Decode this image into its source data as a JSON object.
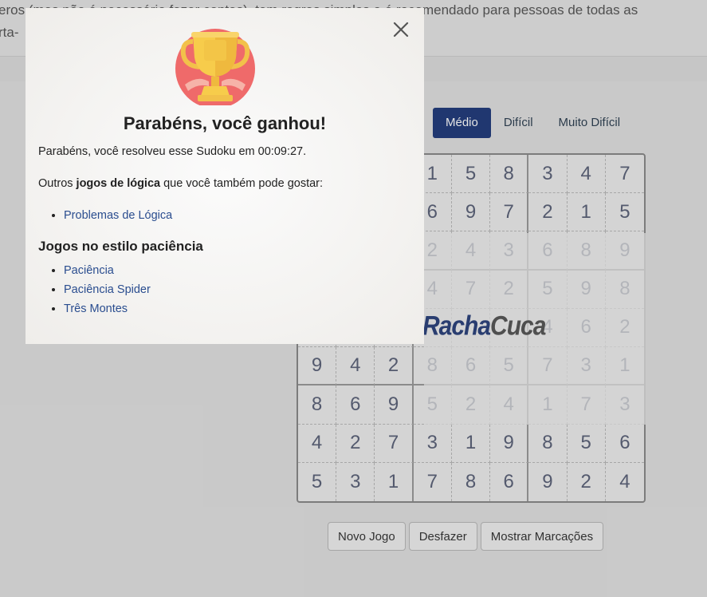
{
  "background": {
    "intro_line1": "eros (mas não é necessário fazer contas), tem regras simples e é recomendado para pessoas de todas as",
    "intro_line2": "rta-",
    "levels": [
      {
        "label": "Médio",
        "active": true
      },
      {
        "label": "Difícil",
        "active": false
      },
      {
        "label": "Muito Difícil",
        "active": false
      }
    ],
    "board": [
      [
        "",
        "",
        "",
        "1",
        "5",
        "8",
        "3",
        "4",
        "7"
      ],
      [
        "",
        "",
        "",
        "6",
        "9",
        "7",
        "2",
        "1",
        "5"
      ],
      [
        "",
        "",
        "",
        "2",
        "4",
        "3",
        "6",
        "8",
        "9"
      ],
      [
        "",
        "",
        "",
        "4",
        "7",
        "2",
        "5",
        "9",
        "8"
      ],
      [
        "",
        "",
        "",
        "",
        "",
        "",
        "4",
        "6",
        "2"
      ],
      [
        "9",
        "4",
        "2",
        "8",
        "6",
        "5",
        "7",
        "3",
        "1"
      ],
      [
        "8",
        "6",
        "9",
        "5",
        "2",
        "4",
        "1",
        "7",
        "3"
      ],
      [
        "4",
        "2",
        "7",
        "3",
        "1",
        "9",
        "8",
        "5",
        "6"
      ],
      [
        "5",
        "3",
        "1",
        "7",
        "8",
        "6",
        "9",
        "2",
        "4"
      ]
    ],
    "watermark_a": "Racha",
    "watermark_b": "Cuca",
    "actions": {
      "new_game": "Novo Jogo",
      "undo": "Desfazer",
      "show_marks": "Mostrar Marcações"
    }
  },
  "modal": {
    "icon": "trophy-icon",
    "close_icon": "close-icon",
    "title": "Parabéns, você ganhou!",
    "message": "Parabéns, você resolveu esse Sudoku em 00:09:27.",
    "others_prefix": "Outros ",
    "others_bold": "jogos de lógica",
    "others_suffix": " que você também pode gostar:",
    "logic_links": [
      "Problemas de Lógica"
    ],
    "solitaire_heading": "Jogos no estilo paciência",
    "solitaire_links": [
      "Paciência",
      "Paciência Spider",
      "Três Montes"
    ]
  },
  "colors": {
    "accent": "#1f3a7a",
    "link": "#2a4d8f",
    "trophy_gold": "#f7cc4b",
    "trophy_bg": "#ef6a6a"
  }
}
